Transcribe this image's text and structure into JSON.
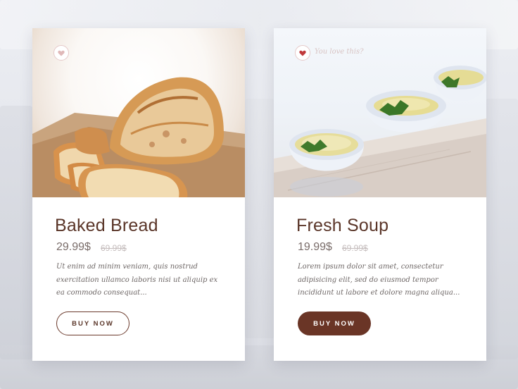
{
  "products": [
    {
      "name": "Baked Bread",
      "price": "29.99$",
      "old_price": "69.99$",
      "description": "Ut enim ad minim veniam, quis nostrud exercitation ullamco laboris nisi ut aliquip ex ea commodo consequat...",
      "button_label": "BUY NOW",
      "favorite": false,
      "favorite_note": "",
      "image": "bread-image"
    },
    {
      "name": "Fresh Soup",
      "price": "19.99$",
      "old_price": "69.99$",
      "description": "Lorem ipsum dolor sit amet, consectetur adipisicing elit, sed do eiusmod tempor incididunt ut labore et dolore magna aliqua...",
      "button_label": "BUY NOW",
      "favorite": true,
      "favorite_note": "You love this?",
      "image": "soup-image"
    }
  ],
  "icons": {
    "favorite": "heart-icon"
  },
  "colors": {
    "brand_brown": "#6a3526",
    "title_brown": "#5a3528",
    "heart_active": "#c0393b",
    "heart_inactive": "#e0b9b9"
  }
}
